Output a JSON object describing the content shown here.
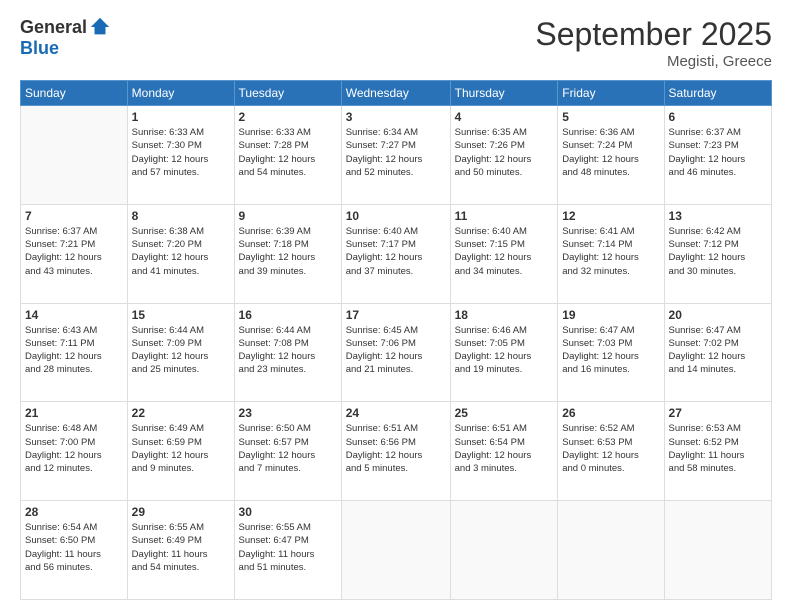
{
  "logo": {
    "general": "General",
    "blue": "Blue"
  },
  "title": "September 2025",
  "subtitle": "Megisti, Greece",
  "days_header": [
    "Sunday",
    "Monday",
    "Tuesday",
    "Wednesday",
    "Thursday",
    "Friday",
    "Saturday"
  ],
  "weeks": [
    [
      {
        "day": "",
        "info": ""
      },
      {
        "day": "1",
        "info": "Sunrise: 6:33 AM\nSunset: 7:30 PM\nDaylight: 12 hours\nand 57 minutes."
      },
      {
        "day": "2",
        "info": "Sunrise: 6:33 AM\nSunset: 7:28 PM\nDaylight: 12 hours\nand 54 minutes."
      },
      {
        "day": "3",
        "info": "Sunrise: 6:34 AM\nSunset: 7:27 PM\nDaylight: 12 hours\nand 52 minutes."
      },
      {
        "day": "4",
        "info": "Sunrise: 6:35 AM\nSunset: 7:26 PM\nDaylight: 12 hours\nand 50 minutes."
      },
      {
        "day": "5",
        "info": "Sunrise: 6:36 AM\nSunset: 7:24 PM\nDaylight: 12 hours\nand 48 minutes."
      },
      {
        "day": "6",
        "info": "Sunrise: 6:37 AM\nSunset: 7:23 PM\nDaylight: 12 hours\nand 46 minutes."
      }
    ],
    [
      {
        "day": "7",
        "info": "Sunrise: 6:37 AM\nSunset: 7:21 PM\nDaylight: 12 hours\nand 43 minutes."
      },
      {
        "day": "8",
        "info": "Sunrise: 6:38 AM\nSunset: 7:20 PM\nDaylight: 12 hours\nand 41 minutes."
      },
      {
        "day": "9",
        "info": "Sunrise: 6:39 AM\nSunset: 7:18 PM\nDaylight: 12 hours\nand 39 minutes."
      },
      {
        "day": "10",
        "info": "Sunrise: 6:40 AM\nSunset: 7:17 PM\nDaylight: 12 hours\nand 37 minutes."
      },
      {
        "day": "11",
        "info": "Sunrise: 6:40 AM\nSunset: 7:15 PM\nDaylight: 12 hours\nand 34 minutes."
      },
      {
        "day": "12",
        "info": "Sunrise: 6:41 AM\nSunset: 7:14 PM\nDaylight: 12 hours\nand 32 minutes."
      },
      {
        "day": "13",
        "info": "Sunrise: 6:42 AM\nSunset: 7:12 PM\nDaylight: 12 hours\nand 30 minutes."
      }
    ],
    [
      {
        "day": "14",
        "info": "Sunrise: 6:43 AM\nSunset: 7:11 PM\nDaylight: 12 hours\nand 28 minutes."
      },
      {
        "day": "15",
        "info": "Sunrise: 6:44 AM\nSunset: 7:09 PM\nDaylight: 12 hours\nand 25 minutes."
      },
      {
        "day": "16",
        "info": "Sunrise: 6:44 AM\nSunset: 7:08 PM\nDaylight: 12 hours\nand 23 minutes."
      },
      {
        "day": "17",
        "info": "Sunrise: 6:45 AM\nSunset: 7:06 PM\nDaylight: 12 hours\nand 21 minutes."
      },
      {
        "day": "18",
        "info": "Sunrise: 6:46 AM\nSunset: 7:05 PM\nDaylight: 12 hours\nand 19 minutes."
      },
      {
        "day": "19",
        "info": "Sunrise: 6:47 AM\nSunset: 7:03 PM\nDaylight: 12 hours\nand 16 minutes."
      },
      {
        "day": "20",
        "info": "Sunrise: 6:47 AM\nSunset: 7:02 PM\nDaylight: 12 hours\nand 14 minutes."
      }
    ],
    [
      {
        "day": "21",
        "info": "Sunrise: 6:48 AM\nSunset: 7:00 PM\nDaylight: 12 hours\nand 12 minutes."
      },
      {
        "day": "22",
        "info": "Sunrise: 6:49 AM\nSunset: 6:59 PM\nDaylight: 12 hours\nand 9 minutes."
      },
      {
        "day": "23",
        "info": "Sunrise: 6:50 AM\nSunset: 6:57 PM\nDaylight: 12 hours\nand 7 minutes."
      },
      {
        "day": "24",
        "info": "Sunrise: 6:51 AM\nSunset: 6:56 PM\nDaylight: 12 hours\nand 5 minutes."
      },
      {
        "day": "25",
        "info": "Sunrise: 6:51 AM\nSunset: 6:54 PM\nDaylight: 12 hours\nand 3 minutes."
      },
      {
        "day": "26",
        "info": "Sunrise: 6:52 AM\nSunset: 6:53 PM\nDaylight: 12 hours\nand 0 minutes."
      },
      {
        "day": "27",
        "info": "Sunrise: 6:53 AM\nSunset: 6:52 PM\nDaylight: 11 hours\nand 58 minutes."
      }
    ],
    [
      {
        "day": "28",
        "info": "Sunrise: 6:54 AM\nSunset: 6:50 PM\nDaylight: 11 hours\nand 56 minutes."
      },
      {
        "day": "29",
        "info": "Sunrise: 6:55 AM\nSunset: 6:49 PM\nDaylight: 11 hours\nand 54 minutes."
      },
      {
        "day": "30",
        "info": "Sunrise: 6:55 AM\nSunset: 6:47 PM\nDaylight: 11 hours\nand 51 minutes."
      },
      {
        "day": "",
        "info": ""
      },
      {
        "day": "",
        "info": ""
      },
      {
        "day": "",
        "info": ""
      },
      {
        "day": "",
        "info": ""
      }
    ]
  ]
}
